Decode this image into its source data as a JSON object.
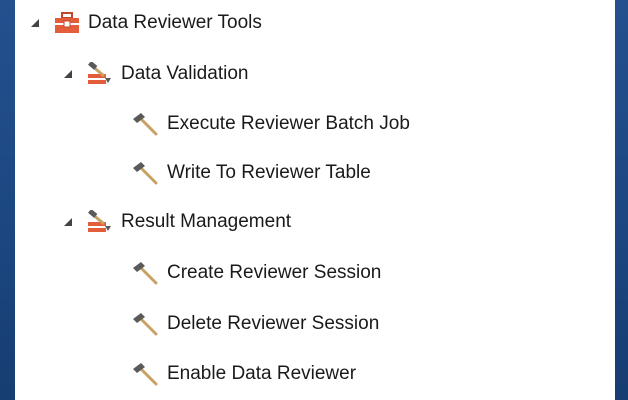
{
  "tree": {
    "root": {
      "label": "Data Reviewer Tools",
      "icon": "toolbox-icon",
      "expanded": true
    },
    "groups": [
      {
        "label": "Data Validation",
        "icon": "toolset-icon",
        "expanded": true,
        "tools": [
          {
            "label": "Execute Reviewer Batch Job",
            "icon": "hammer-icon"
          },
          {
            "label": "Write To Reviewer Table",
            "icon": "hammer-icon"
          }
        ]
      },
      {
        "label": "Result Management",
        "icon": "toolset-icon",
        "expanded": true,
        "tools": [
          {
            "label": "Create Reviewer Session",
            "icon": "hammer-icon"
          },
          {
            "label": "Delete Reviewer Session",
            "icon": "hammer-icon"
          },
          {
            "label": "Enable Data Reviewer",
            "icon": "hammer-icon"
          }
        ]
      }
    ]
  },
  "colors": {
    "background_blue": "#1f4a87",
    "panel": "#ffffff",
    "toolbox_red": "#e35d3a",
    "hammer_head": "#5a5a5a",
    "hammer_handle": "#c8a165"
  }
}
